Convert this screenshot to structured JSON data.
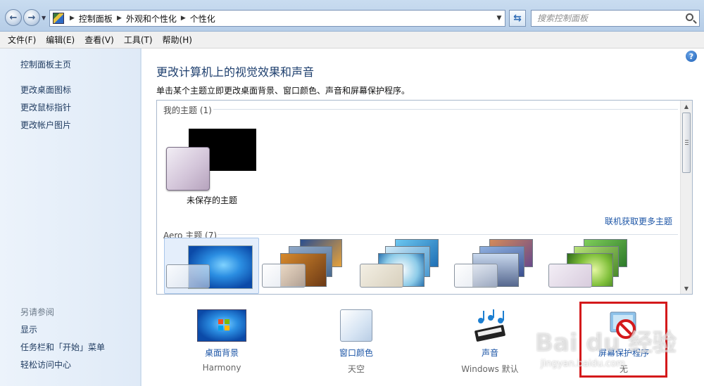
{
  "address": {
    "icon": "control-panel-icon",
    "crumbs": [
      "控制面板",
      "外观和个性化",
      "个性化"
    ]
  },
  "search": {
    "placeholder": "搜索控制面板"
  },
  "menu": [
    "文件(F)",
    "编辑(E)",
    "查看(V)",
    "工具(T)",
    "帮助(H)"
  ],
  "left": {
    "home": "控制面板主页",
    "links": [
      "更改桌面图标",
      "更改鼠标指针",
      "更改帐户图片"
    ],
    "see_also_heading": "另请参阅",
    "see_also": [
      "显示",
      "任务栏和「开始」菜单",
      "轻松访问中心"
    ]
  },
  "main": {
    "title": "更改计算机上的视觉效果和声音",
    "description": "单击某个主题立即更改桌面背景、窗口颜色、声音和屏幕保护程序。",
    "my_themes_heading": "我的主题 (1)",
    "unsaved_theme": "未保存的主题",
    "online_link": "联机获取更多主题",
    "aero_heading": "Aero 主题 (7)"
  },
  "settings": [
    {
      "label": "桌面背景",
      "value": "Harmony",
      "icon": "desktop-background-icon"
    },
    {
      "label": "窗口颜色",
      "value": "天空",
      "icon": "window-color-icon"
    },
    {
      "label": "声音",
      "value": "Windows 默认",
      "icon": "music-notes-icon"
    },
    {
      "label": "屏幕保护程序",
      "value": "无",
      "icon": "screensaver-icon"
    }
  ],
  "colors": {
    "accent": "#1c55a6",
    "highlight": "#d4191b"
  },
  "watermark": {
    "logo": "Bai du 经验",
    "site": "jingyan.baidu.com"
  }
}
